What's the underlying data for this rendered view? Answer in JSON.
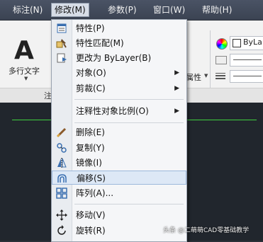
{
  "menubar": {
    "items": [
      "标注(N)",
      "修改(M)",
      "参数(P)",
      "窗口(W)",
      "帮助(H)"
    ]
  },
  "ribbon": {
    "big_glyph": "A",
    "mtext_label": "多行文字",
    "panel_label_left": "注",
    "properties_label": "属性",
    "layer_name": "ByLa"
  },
  "dropdown": {
    "items": [
      {
        "label": "特性(P)",
        "icon": "properties-icon"
      },
      {
        "label": "特性匹配(M)",
        "icon": "match-properties-icon"
      },
      {
        "label": "更改为 ByLayer(B)",
        "icon": "bylayer-icon"
      },
      {
        "label": "对象(O)",
        "icon": "",
        "submenu": true
      },
      {
        "label": "剪裁(C)",
        "icon": "",
        "submenu": true
      },
      {
        "label": "注释性对象比例(O)",
        "icon": "",
        "submenu": true
      },
      {
        "label": "删除(E)",
        "icon": "erase-icon"
      },
      {
        "label": "复制(Y)",
        "icon": "copy-icon"
      },
      {
        "label": "镜像(I)",
        "icon": "mirror-icon"
      },
      {
        "label": "偏移(S)",
        "icon": "offset-icon"
      },
      {
        "label": "阵列(A)...",
        "icon": "array-icon"
      },
      {
        "label": "移动(V)",
        "icon": "move-icon"
      },
      {
        "label": "旋转(R)",
        "icon": "rotate-icon"
      }
    ]
  },
  "watermark": "头条 @二萌萌CAD零基础教学",
  "colors": {
    "menubar": "#3f4757",
    "highlight": "#dde8f6",
    "canvas": "#21262d",
    "green_line": "#3fd13f"
  }
}
